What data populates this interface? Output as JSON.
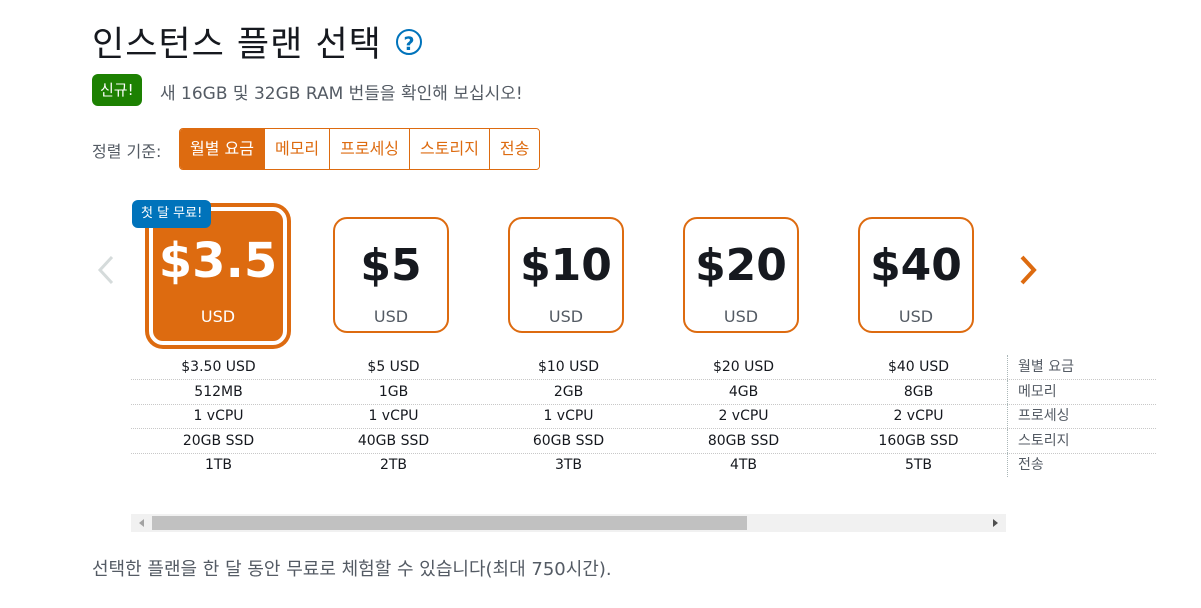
{
  "header": {
    "title": "인스턴스 플랜 선택",
    "help_icon": "?"
  },
  "announcement": {
    "badge": "신규!",
    "text": "새 16GB 및 32GB RAM 번들을 확인해 보십시오!"
  },
  "sort": {
    "label": "정렬 기준:",
    "options": [
      "월별 요금",
      "메모리",
      "프로세싱",
      "스토리지",
      "전송"
    ],
    "selected": "월별 요금"
  },
  "carousel": {
    "free_badge": "첫 달 무료!",
    "selected_index": 0,
    "plans": [
      {
        "price": "$3.5",
        "currency": "USD"
      },
      {
        "price": "$5",
        "currency": "USD"
      },
      {
        "price": "$10",
        "currency": "USD"
      },
      {
        "price": "$20",
        "currency": "USD"
      },
      {
        "price": "$40",
        "currency": "USD"
      }
    ]
  },
  "specs": {
    "rows": [
      {
        "label": "월별 요금",
        "values": [
          "$3.50 USD",
          "$5 USD",
          "$10 USD",
          "$20 USD",
          "$40 USD"
        ]
      },
      {
        "label": "메모리",
        "values": [
          "512MB",
          "1GB",
          "2GB",
          "4GB",
          "8GB"
        ]
      },
      {
        "label": "프로세싱",
        "values": [
          "1 vCPU",
          "1 vCPU",
          "1 vCPU",
          "2 vCPU",
          "2 vCPU"
        ]
      },
      {
        "label": "스토리지",
        "values": [
          "20GB SSD",
          "40GB SSD",
          "60GB SSD",
          "80GB SSD",
          "160GB SSD"
        ]
      },
      {
        "label": "전송",
        "values": [
          "1TB",
          "2TB",
          "3TB",
          "4TB",
          "5TB"
        ]
      }
    ]
  },
  "scrollbar": {
    "position_fraction": 0.0,
    "visible_fraction": 0.68
  },
  "footer": {
    "text": "선택한 플랜을 한 달 동안 무료로 체험할 수 있습니다(최대 750시간)."
  },
  "colors": {
    "accent": "#dd6b10",
    "badge_new": "#1d8102",
    "badge_free": "#0073bb",
    "text_secondary": "#545b64"
  }
}
